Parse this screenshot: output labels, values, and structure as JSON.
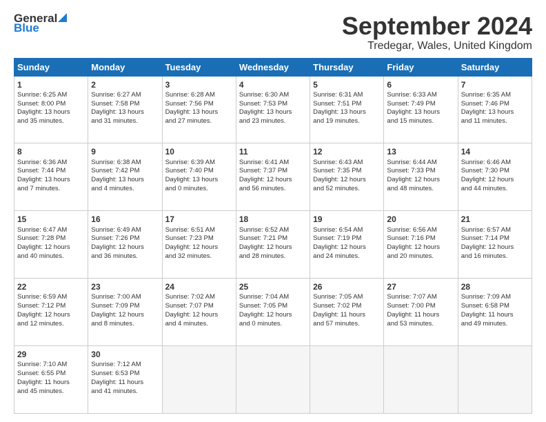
{
  "header": {
    "logo_general": "General",
    "logo_blue": "Blue",
    "month_title": "September 2024",
    "location": "Tredegar, Wales, United Kingdom"
  },
  "calendar": {
    "days_of_week": [
      "Sunday",
      "Monday",
      "Tuesday",
      "Wednesday",
      "Thursday",
      "Friday",
      "Saturday"
    ],
    "weeks": [
      [
        {
          "day": "1",
          "info": "Sunrise: 6:25 AM\nSunset: 8:00 PM\nDaylight: 13 hours\nand 35 minutes."
        },
        {
          "day": "2",
          "info": "Sunrise: 6:27 AM\nSunset: 7:58 PM\nDaylight: 13 hours\nand 31 minutes."
        },
        {
          "day": "3",
          "info": "Sunrise: 6:28 AM\nSunset: 7:56 PM\nDaylight: 13 hours\nand 27 minutes."
        },
        {
          "day": "4",
          "info": "Sunrise: 6:30 AM\nSunset: 7:53 PM\nDaylight: 13 hours\nand 23 minutes."
        },
        {
          "day": "5",
          "info": "Sunrise: 6:31 AM\nSunset: 7:51 PM\nDaylight: 13 hours\nand 19 minutes."
        },
        {
          "day": "6",
          "info": "Sunrise: 6:33 AM\nSunset: 7:49 PM\nDaylight: 13 hours\nand 15 minutes."
        },
        {
          "day": "7",
          "info": "Sunrise: 6:35 AM\nSunset: 7:46 PM\nDaylight: 13 hours\nand 11 minutes."
        }
      ],
      [
        {
          "day": "8",
          "info": "Sunrise: 6:36 AM\nSunset: 7:44 PM\nDaylight: 13 hours\nand 7 minutes."
        },
        {
          "day": "9",
          "info": "Sunrise: 6:38 AM\nSunset: 7:42 PM\nDaylight: 13 hours\nand 4 minutes."
        },
        {
          "day": "10",
          "info": "Sunrise: 6:39 AM\nSunset: 7:40 PM\nDaylight: 13 hours\nand 0 minutes."
        },
        {
          "day": "11",
          "info": "Sunrise: 6:41 AM\nSunset: 7:37 PM\nDaylight: 12 hours\nand 56 minutes."
        },
        {
          "day": "12",
          "info": "Sunrise: 6:43 AM\nSunset: 7:35 PM\nDaylight: 12 hours\nand 52 minutes."
        },
        {
          "day": "13",
          "info": "Sunrise: 6:44 AM\nSunset: 7:33 PM\nDaylight: 12 hours\nand 48 minutes."
        },
        {
          "day": "14",
          "info": "Sunrise: 6:46 AM\nSunset: 7:30 PM\nDaylight: 12 hours\nand 44 minutes."
        }
      ],
      [
        {
          "day": "15",
          "info": "Sunrise: 6:47 AM\nSunset: 7:28 PM\nDaylight: 12 hours\nand 40 minutes."
        },
        {
          "day": "16",
          "info": "Sunrise: 6:49 AM\nSunset: 7:26 PM\nDaylight: 12 hours\nand 36 minutes."
        },
        {
          "day": "17",
          "info": "Sunrise: 6:51 AM\nSunset: 7:23 PM\nDaylight: 12 hours\nand 32 minutes."
        },
        {
          "day": "18",
          "info": "Sunrise: 6:52 AM\nSunset: 7:21 PM\nDaylight: 12 hours\nand 28 minutes."
        },
        {
          "day": "19",
          "info": "Sunrise: 6:54 AM\nSunset: 7:19 PM\nDaylight: 12 hours\nand 24 minutes."
        },
        {
          "day": "20",
          "info": "Sunrise: 6:56 AM\nSunset: 7:16 PM\nDaylight: 12 hours\nand 20 minutes."
        },
        {
          "day": "21",
          "info": "Sunrise: 6:57 AM\nSunset: 7:14 PM\nDaylight: 12 hours\nand 16 minutes."
        }
      ],
      [
        {
          "day": "22",
          "info": "Sunrise: 6:59 AM\nSunset: 7:12 PM\nDaylight: 12 hours\nand 12 minutes."
        },
        {
          "day": "23",
          "info": "Sunrise: 7:00 AM\nSunset: 7:09 PM\nDaylight: 12 hours\nand 8 minutes."
        },
        {
          "day": "24",
          "info": "Sunrise: 7:02 AM\nSunset: 7:07 PM\nDaylight: 12 hours\nand 4 minutes."
        },
        {
          "day": "25",
          "info": "Sunrise: 7:04 AM\nSunset: 7:05 PM\nDaylight: 12 hours\nand 0 minutes."
        },
        {
          "day": "26",
          "info": "Sunrise: 7:05 AM\nSunset: 7:02 PM\nDaylight: 11 hours\nand 57 minutes."
        },
        {
          "day": "27",
          "info": "Sunrise: 7:07 AM\nSunset: 7:00 PM\nDaylight: 11 hours\nand 53 minutes."
        },
        {
          "day": "28",
          "info": "Sunrise: 7:09 AM\nSunset: 6:58 PM\nDaylight: 11 hours\nand 49 minutes."
        }
      ],
      [
        {
          "day": "29",
          "info": "Sunrise: 7:10 AM\nSunset: 6:55 PM\nDaylight: 11 hours\nand 45 minutes."
        },
        {
          "day": "30",
          "info": "Sunrise: 7:12 AM\nSunset: 6:53 PM\nDaylight: 11 hours\nand 41 minutes."
        },
        {
          "day": "",
          "info": ""
        },
        {
          "day": "",
          "info": ""
        },
        {
          "day": "",
          "info": ""
        },
        {
          "day": "",
          "info": ""
        },
        {
          "day": "",
          "info": ""
        }
      ]
    ]
  }
}
